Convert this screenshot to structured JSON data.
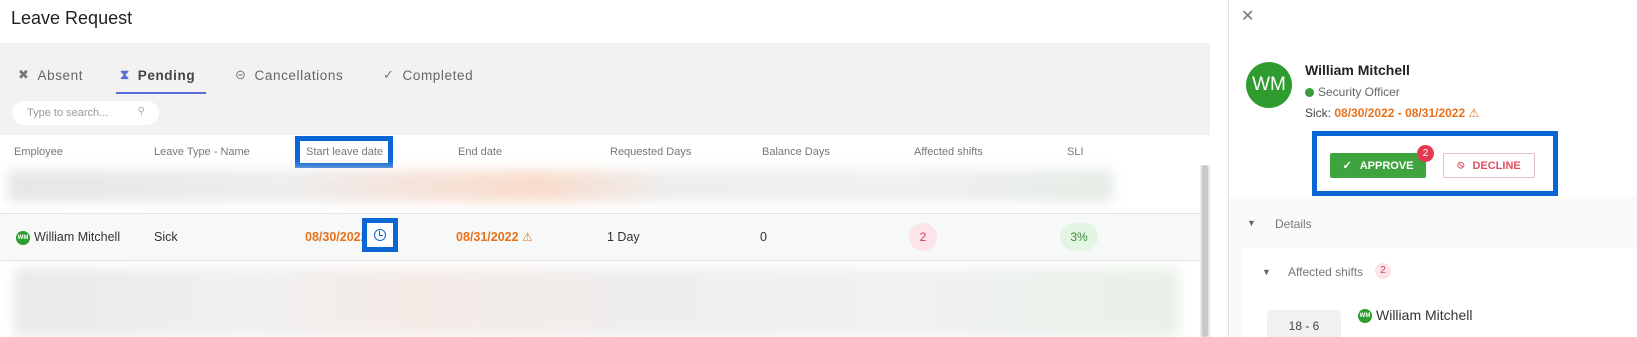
{
  "page": {
    "title": "Leave Request"
  },
  "tabs": [
    {
      "label": "Absent",
      "icon": "person-off-icon"
    },
    {
      "label": "Pending",
      "icon": "hourglass-icon",
      "active": true
    },
    {
      "label": "Cancellations",
      "icon": "minus-circle-icon"
    },
    {
      "label": "Completed",
      "icon": "check-icon"
    }
  ],
  "search": {
    "placeholder": "Type to search..."
  },
  "table": {
    "headers": [
      "Employee",
      "Leave Type - Name",
      "Start leave date",
      "End date",
      "Requested Days",
      "Balance Days",
      "Affected shifts",
      "SLI"
    ],
    "row": {
      "avatar_initials": "WM",
      "employee": "William Mitchell",
      "leave_type": "Sick",
      "start_date": "08/30/2022",
      "end_date": "08/31/2022",
      "requested_days": "1 Day",
      "balance_days": "0",
      "affected_shifts": "2",
      "sli": "3%"
    }
  },
  "panel": {
    "avatar_initials": "WM",
    "name": "William Mitchell",
    "role": "Security Officer",
    "leave_type_prefix": "Sick:",
    "leave_dates": "08/30/2022 - 08/31/2022",
    "approve_label": "APPROVE",
    "approve_badge": "2",
    "decline_label": "DECLINE",
    "details_label": "Details",
    "affected_shifts_label": "Affected shifts",
    "affected_shifts_count": "2",
    "shift_time": "18 - 6",
    "shift_employee_initials": "WM",
    "shift_employee": "William Mitchell"
  },
  "colors": {
    "accent": "#5b6bd6",
    "highlight": "#0a66d4",
    "approve": "#3fa43f",
    "decline": "#e05060",
    "warning": "#e8711a",
    "avatar": "#2e9c2e"
  }
}
